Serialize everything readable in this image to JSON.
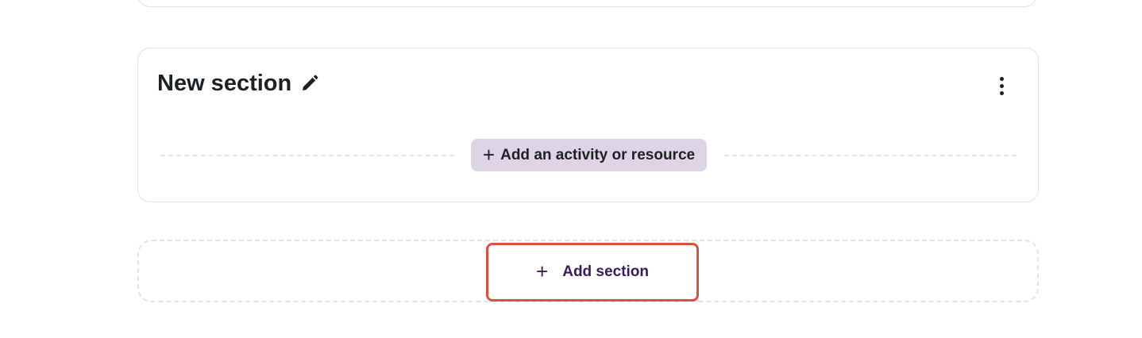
{
  "section": {
    "title": "New section",
    "edit_icon": "pencil-icon",
    "menu_icon": "kebab-menu-icon",
    "add_activity_label": "Add an activity or resource",
    "add_activity_icon": "plus-icon"
  },
  "add_section": {
    "label": "Add section",
    "icon": "plus-icon"
  },
  "colors": {
    "accent_bg": "#ddd5e6",
    "add_section_text": "#3b1a5c",
    "highlight_border": "#d9523e"
  }
}
